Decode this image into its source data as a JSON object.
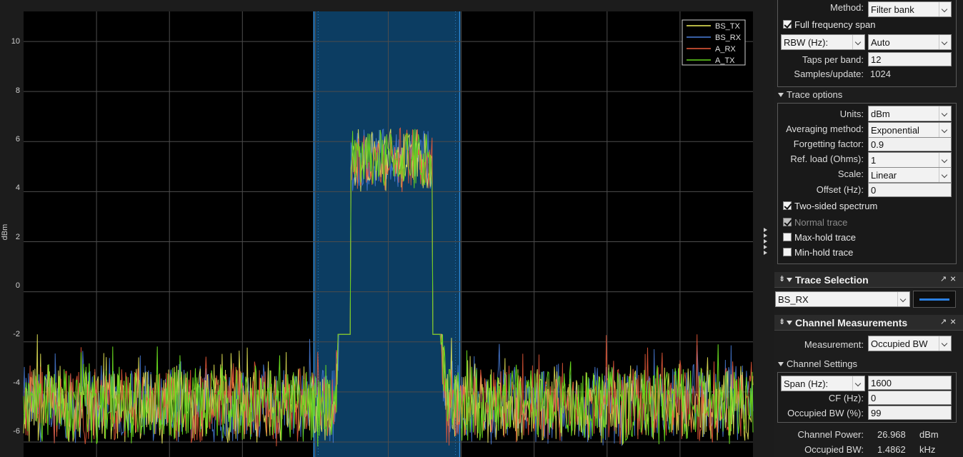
{
  "plot": {
    "ylabel": "dBm",
    "y_ticks": [
      "10",
      "8",
      "6",
      "4",
      "2",
      "0",
      "-2",
      "-4",
      "-6"
    ],
    "legend": [
      {
        "name": "BS_TX",
        "color": "#f2f25a"
      },
      {
        "name": "BS_RX",
        "color": "#4a7fdc"
      },
      {
        "name": "A_RX",
        "color": "#ec5a3a"
      },
      {
        "name": "A_TX",
        "color": "#66d61e"
      }
    ],
    "colors": {
      "background": "#000000",
      "grid": "#4d4d4d",
      "band": "#0c3d62",
      "band_edge": "#2f8fe0"
    }
  },
  "chart_data": {
    "type": "line",
    "ylabel": "dBm",
    "ylim": [
      -6.6,
      11.2
    ],
    "y_ticks": [
      10,
      8,
      6,
      4,
      2,
      0,
      -2,
      -4,
      -6
    ],
    "grid": true,
    "legend_position": "top-right",
    "series": [
      {
        "name": "BS_TX",
        "color": "#f2f25a"
      },
      {
        "name": "BS_RX",
        "color": "#4a7fdc"
      },
      {
        "name": "A_RX",
        "color": "#ec5a3a"
      },
      {
        "name": "A_TX",
        "color": "#66d61e"
      }
    ],
    "spectrum_shape": {
      "noise_floor_dbm": -4.5,
      "noise_range_dbm": [
        -6.4,
        -1.7
      ],
      "passband_dbm": 5.3,
      "passband_range_dbm": [
        3.6,
        8.1
      ],
      "occupied_band_fraction": [
        0.398,
        0.598
      ],
      "rise_fraction": [
        0.428,
        0.448
      ],
      "fall_fraction": [
        0.561,
        0.58
      ]
    }
  },
  "spectrum_settings": {
    "method_label": "Method:",
    "method_value": "Filter bank",
    "full_freq_span_label": "Full frequency span",
    "rbw_value": "RBW (Hz):",
    "rbw_setting": "Auto",
    "taps_label": "Taps per band:",
    "taps_value": "12",
    "samples_label": "Samples/update:",
    "samples_value": "1024"
  },
  "trace_options": {
    "header": "Trace options",
    "units_label": "Units:",
    "units_value": "dBm",
    "averaging_label": "Averaging method:",
    "averaging_value": "Exponential",
    "forgetting_label": "Forgetting factor:",
    "forgetting_value": "0.9",
    "refload_label": "Ref. load (Ohms):",
    "refload_value": "1",
    "scale_label": "Scale:",
    "scale_value": "Linear",
    "offset_label": "Offset (Hz):",
    "offset_value": "0",
    "two_sided_label": "Two-sided spectrum",
    "normal_trace_label": "Normal trace",
    "maxhold_label": "Max-hold trace",
    "minhold_label": "Min-hold trace"
  },
  "trace_selection": {
    "title": "Trace Selection",
    "selected": "BS_RX",
    "swatch_color": "#2b7fe0"
  },
  "channel_measurements": {
    "title": "Channel Measurements",
    "measurement_label": "Measurement:",
    "measurement_value": "Occupied BW",
    "channel_settings_header": "Channel Settings",
    "span_value": "Span (Hz):",
    "span_setting": "1600",
    "cf_label": "CF (Hz):",
    "cf_value": "0",
    "occ_pct_label": "Occupied BW (%):",
    "occ_pct_value": "99",
    "channel_power_label": "Channel Power:",
    "channel_power_value": "26.968",
    "channel_power_unit": "dBm",
    "occupied_bw_label": "Occupied BW:",
    "occupied_bw_value": "1.4862",
    "occupied_bw_unit": "kHz"
  }
}
